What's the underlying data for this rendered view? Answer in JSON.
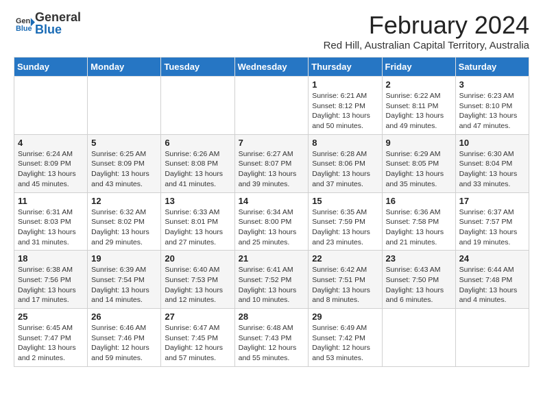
{
  "logo": {
    "general": "General",
    "blue": "Blue"
  },
  "header": {
    "title": "February 2024",
    "subtitle": "Red Hill, Australian Capital Territory, Australia"
  },
  "days_of_week": [
    "Sunday",
    "Monday",
    "Tuesday",
    "Wednesday",
    "Thursday",
    "Friday",
    "Saturday"
  ],
  "weeks": [
    [
      {
        "day": "",
        "info": ""
      },
      {
        "day": "",
        "info": ""
      },
      {
        "day": "",
        "info": ""
      },
      {
        "day": "",
        "info": ""
      },
      {
        "day": "1",
        "info": "Sunrise: 6:21 AM\nSunset: 8:12 PM\nDaylight: 13 hours\nand 50 minutes."
      },
      {
        "day": "2",
        "info": "Sunrise: 6:22 AM\nSunset: 8:11 PM\nDaylight: 13 hours\nand 49 minutes."
      },
      {
        "day": "3",
        "info": "Sunrise: 6:23 AM\nSunset: 8:10 PM\nDaylight: 13 hours\nand 47 minutes."
      }
    ],
    [
      {
        "day": "4",
        "info": "Sunrise: 6:24 AM\nSunset: 8:09 PM\nDaylight: 13 hours\nand 45 minutes."
      },
      {
        "day": "5",
        "info": "Sunrise: 6:25 AM\nSunset: 8:09 PM\nDaylight: 13 hours\nand 43 minutes."
      },
      {
        "day": "6",
        "info": "Sunrise: 6:26 AM\nSunset: 8:08 PM\nDaylight: 13 hours\nand 41 minutes."
      },
      {
        "day": "7",
        "info": "Sunrise: 6:27 AM\nSunset: 8:07 PM\nDaylight: 13 hours\nand 39 minutes."
      },
      {
        "day": "8",
        "info": "Sunrise: 6:28 AM\nSunset: 8:06 PM\nDaylight: 13 hours\nand 37 minutes."
      },
      {
        "day": "9",
        "info": "Sunrise: 6:29 AM\nSunset: 8:05 PM\nDaylight: 13 hours\nand 35 minutes."
      },
      {
        "day": "10",
        "info": "Sunrise: 6:30 AM\nSunset: 8:04 PM\nDaylight: 13 hours\nand 33 minutes."
      }
    ],
    [
      {
        "day": "11",
        "info": "Sunrise: 6:31 AM\nSunset: 8:03 PM\nDaylight: 13 hours\nand 31 minutes."
      },
      {
        "day": "12",
        "info": "Sunrise: 6:32 AM\nSunset: 8:02 PM\nDaylight: 13 hours\nand 29 minutes."
      },
      {
        "day": "13",
        "info": "Sunrise: 6:33 AM\nSunset: 8:01 PM\nDaylight: 13 hours\nand 27 minutes."
      },
      {
        "day": "14",
        "info": "Sunrise: 6:34 AM\nSunset: 8:00 PM\nDaylight: 13 hours\nand 25 minutes."
      },
      {
        "day": "15",
        "info": "Sunrise: 6:35 AM\nSunset: 7:59 PM\nDaylight: 13 hours\nand 23 minutes."
      },
      {
        "day": "16",
        "info": "Sunrise: 6:36 AM\nSunset: 7:58 PM\nDaylight: 13 hours\nand 21 minutes."
      },
      {
        "day": "17",
        "info": "Sunrise: 6:37 AM\nSunset: 7:57 PM\nDaylight: 13 hours\nand 19 minutes."
      }
    ],
    [
      {
        "day": "18",
        "info": "Sunrise: 6:38 AM\nSunset: 7:56 PM\nDaylight: 13 hours\nand 17 minutes."
      },
      {
        "day": "19",
        "info": "Sunrise: 6:39 AM\nSunset: 7:54 PM\nDaylight: 13 hours\nand 14 minutes."
      },
      {
        "day": "20",
        "info": "Sunrise: 6:40 AM\nSunset: 7:53 PM\nDaylight: 13 hours\nand 12 minutes."
      },
      {
        "day": "21",
        "info": "Sunrise: 6:41 AM\nSunset: 7:52 PM\nDaylight: 13 hours\nand 10 minutes."
      },
      {
        "day": "22",
        "info": "Sunrise: 6:42 AM\nSunset: 7:51 PM\nDaylight: 13 hours\nand 8 minutes."
      },
      {
        "day": "23",
        "info": "Sunrise: 6:43 AM\nSunset: 7:50 PM\nDaylight: 13 hours\nand 6 minutes."
      },
      {
        "day": "24",
        "info": "Sunrise: 6:44 AM\nSunset: 7:48 PM\nDaylight: 13 hours\nand 4 minutes."
      }
    ],
    [
      {
        "day": "25",
        "info": "Sunrise: 6:45 AM\nSunset: 7:47 PM\nDaylight: 13 hours\nand 2 minutes."
      },
      {
        "day": "26",
        "info": "Sunrise: 6:46 AM\nSunset: 7:46 PM\nDaylight: 12 hours\nand 59 minutes."
      },
      {
        "day": "27",
        "info": "Sunrise: 6:47 AM\nSunset: 7:45 PM\nDaylight: 12 hours\nand 57 minutes."
      },
      {
        "day": "28",
        "info": "Sunrise: 6:48 AM\nSunset: 7:43 PM\nDaylight: 12 hours\nand 55 minutes."
      },
      {
        "day": "29",
        "info": "Sunrise: 6:49 AM\nSunset: 7:42 PM\nDaylight: 12 hours\nand 53 minutes."
      },
      {
        "day": "",
        "info": ""
      },
      {
        "day": "",
        "info": ""
      }
    ]
  ]
}
